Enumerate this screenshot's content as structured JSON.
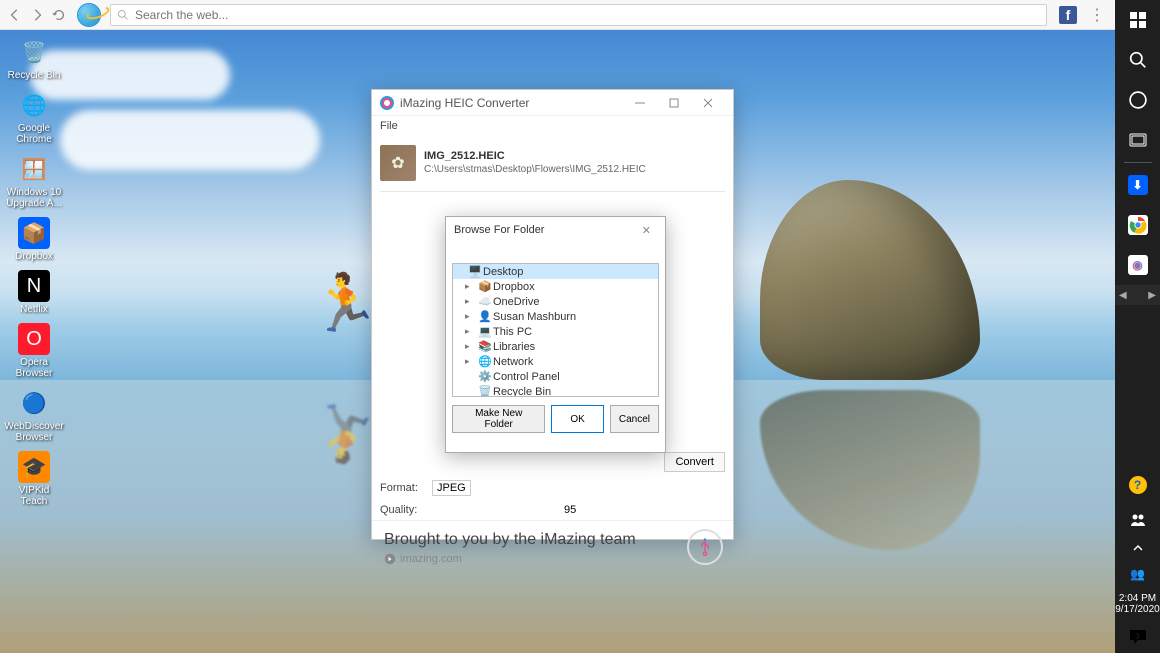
{
  "browser_bar": {
    "search_placeholder": "Search the web...",
    "search_value": ""
  },
  "desktop_icons": [
    {
      "label": "Recycle Bin",
      "icon": "🗑️",
      "bg": ""
    },
    {
      "label": "Google Chrome",
      "icon": "🌐",
      "bg": ""
    },
    {
      "label": "Windows 10 Upgrade A...",
      "icon": "🪟",
      "bg": ""
    },
    {
      "label": "Dropbox",
      "icon": "📦",
      "bg": "#0061ff"
    },
    {
      "label": "Netflix",
      "icon": "N",
      "bg": "#000"
    },
    {
      "label": "Opera Browser",
      "icon": "O",
      "bg": "#ff1b2d"
    },
    {
      "label": "WebDiscover Browser",
      "icon": "🔵",
      "bg": ""
    },
    {
      "label": "VIPKid Teach",
      "icon": "🎓",
      "bg": "#ff8800"
    }
  ],
  "app": {
    "title": "iMazing HEIC Converter",
    "menu_file": "File",
    "file_name": "IMG_2512.HEIC",
    "file_path": "C:\\Users\\stmas\\Desktop\\Flowers\\IMG_2512.HEIC",
    "format_label": "Format:",
    "format_value": "JPEG",
    "quality_label": "Quality:",
    "quality_value": "95",
    "convert_label": "Convert",
    "footer_title": "Brought to you by the iMazing team",
    "footer_link": "imazing.com"
  },
  "browse": {
    "title": "Browse For Folder",
    "nodes": [
      {
        "label": "Desktop",
        "icon": "🖥️",
        "expandable": false,
        "selected": true,
        "indent": 0,
        "color": "#1e90ff"
      },
      {
        "label": "Dropbox",
        "icon": "📦",
        "expandable": true,
        "selected": false,
        "indent": 1,
        "color": "#0061ff"
      },
      {
        "label": "OneDrive",
        "icon": "☁️",
        "expandable": true,
        "selected": false,
        "indent": 1,
        "color": "#0078d4"
      },
      {
        "label": "Susan Mashburn",
        "icon": "👤",
        "expandable": true,
        "selected": false,
        "indent": 1,
        "color": "#888"
      },
      {
        "label": "This PC",
        "icon": "💻",
        "expandable": true,
        "selected": false,
        "indent": 1,
        "color": "#555"
      },
      {
        "label": "Libraries",
        "icon": "📚",
        "expandable": true,
        "selected": false,
        "indent": 1,
        "color": "#d4a017"
      },
      {
        "label": "Network",
        "icon": "🌐",
        "expandable": true,
        "selected": false,
        "indent": 1,
        "color": "#3080c0"
      },
      {
        "label": "Control Panel",
        "icon": "⚙️",
        "expandable": false,
        "selected": false,
        "indent": 1,
        "color": "#3080c0"
      },
      {
        "label": "Recycle Bin",
        "icon": "🗑️",
        "expandable": false,
        "selected": false,
        "indent": 1,
        "color": "#888"
      }
    ],
    "make_new_folder": "Make New Folder",
    "ok": "OK",
    "cancel": "Cancel"
  },
  "sidebar": {
    "time": "2:04 PM",
    "date": "9/17/2020"
  }
}
